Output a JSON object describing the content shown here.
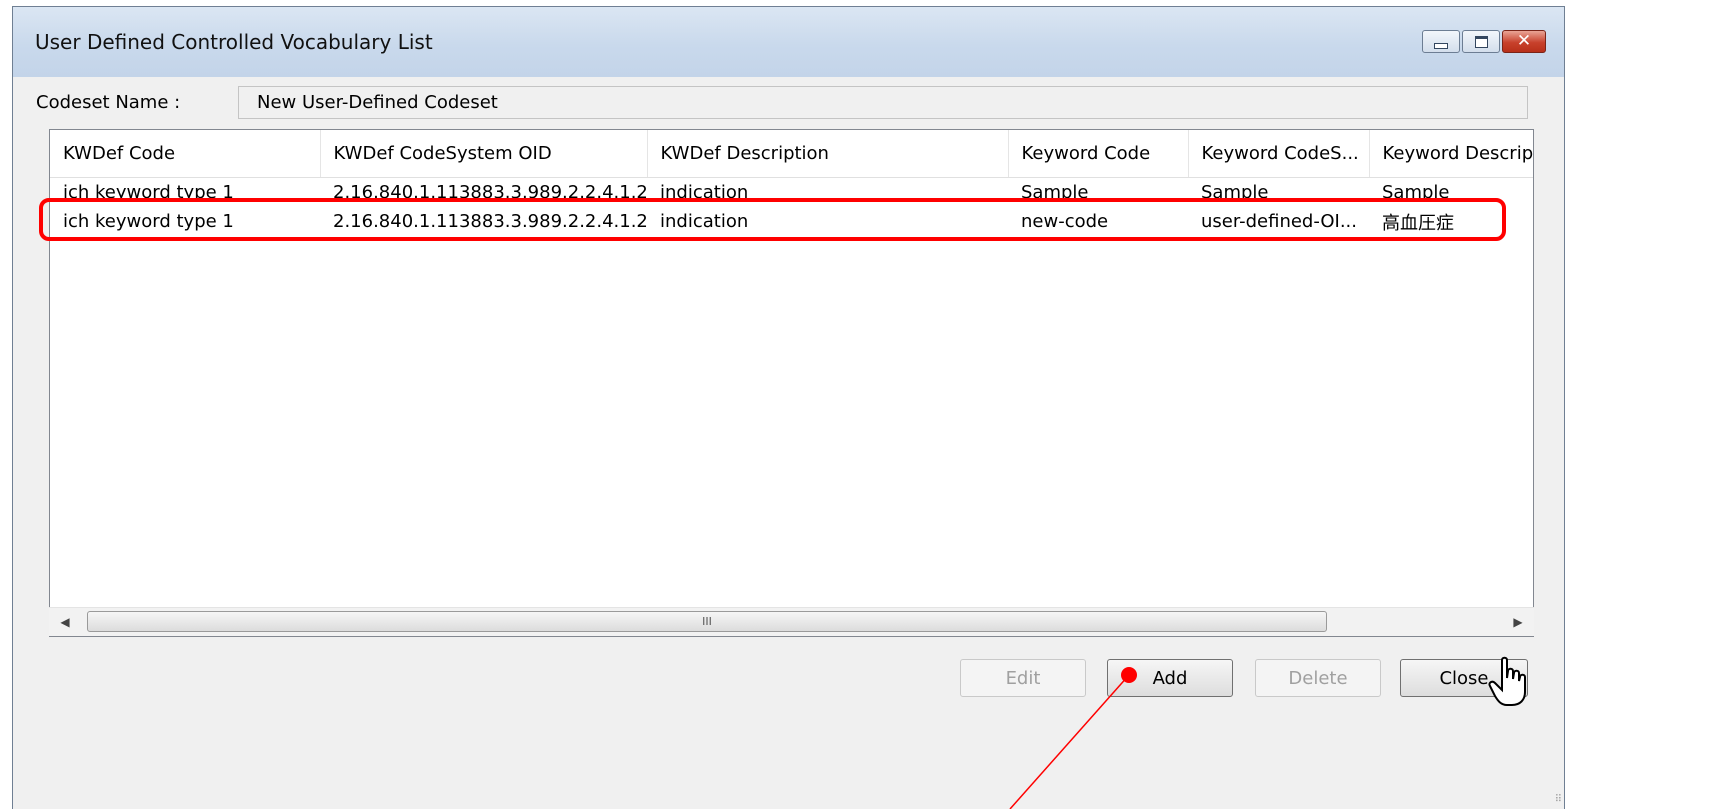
{
  "window": {
    "title": "User Defined Controlled Vocabulary List",
    "controls": {
      "minimize": "minimize-icon",
      "maximize": "maximize-icon",
      "close": "close-icon"
    }
  },
  "codeset": {
    "label": "Codeset Name :",
    "value": "New User-Defined Codeset"
  },
  "table": {
    "columns": [
      "KWDef Code",
      "KWDef CodeSystem OID",
      "KWDef Description",
      "Keyword Code",
      "Keyword CodeS...",
      "Keyword Descrip"
    ],
    "rows": [
      [
        "ich keyword type 1",
        "2.16.840.1.113883.3.989.2.2.4.1.2",
        "indication",
        "Sample",
        "Sample",
        "Sample"
      ],
      [
        "ich keyword type 1",
        "2.16.840.1.113883.3.989.2.2.4.1.2",
        "indication",
        "new-code",
        "user-defined-OI...",
        "高血圧症"
      ]
    ],
    "highlighted_row": 1
  },
  "scrollbar": {
    "thumb_grip": "III",
    "left_arrow": "◀",
    "right_arrow": "▶"
  },
  "buttons": {
    "edit": "Edit",
    "add": "Add",
    "delete": "Delete",
    "close": "Close"
  },
  "annotation": {
    "color": "#ff0000"
  }
}
